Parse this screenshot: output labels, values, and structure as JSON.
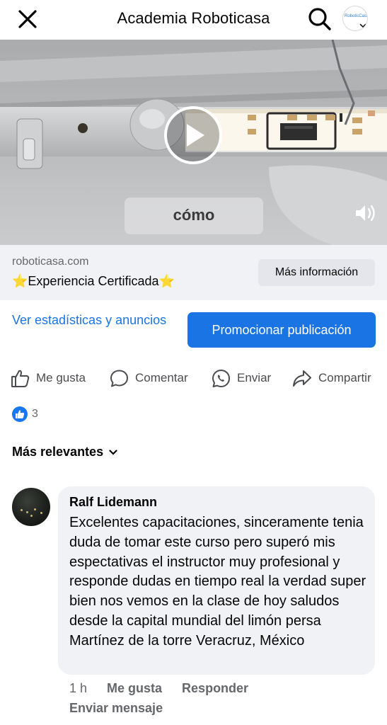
{
  "header": {
    "title": "Academia Roboticasa",
    "close_icon": "close-icon",
    "search_icon": "search-icon",
    "page_avatar_text": "RoboticCasa"
  },
  "video": {
    "caption": "cómo",
    "play_icon": "play-icon",
    "volume_icon": "volume-icon"
  },
  "link_preview": {
    "domain": "roboticasa.com",
    "headline": "⭐Experiencia Certificada⭐",
    "button_label": "Más información"
  },
  "promo": {
    "stats_link": "Ver estadísticas y anuncios",
    "promote_label": "Promocionar publicación"
  },
  "actions": [
    {
      "label": "Me gusta",
      "icon": "thumbs-up-icon"
    },
    {
      "label": "Comentar",
      "icon": "comment-icon"
    },
    {
      "label": "Enviar",
      "icon": "whatsapp-icon"
    },
    {
      "label": "Compartir",
      "icon": "share-icon"
    }
  ],
  "reactions": {
    "count": "3",
    "icon": "like-reaction-icon"
  },
  "sort": {
    "label": "Más relevantes"
  },
  "comment": {
    "author": "Ralf Lidemann",
    "text": "Excelentes capacitaciones, sinceramente tenia duda de tomar este curso pero superó mis espectativas el instructor muy profesional y responde dudas en tiempo real la verdad super bien nos vemos en la clase de hoy saludos desde la capital mundial del limón persa Martínez de la torre Veracruz, México",
    "time": "1 h",
    "like_label": "Me gusta",
    "reply_label": "Responder",
    "send_message_label": "Enviar mensaje"
  },
  "colors": {
    "accent": "#1b74e4",
    "bar_background": "#f0f2f5",
    "secondary_text": "#65676b"
  }
}
